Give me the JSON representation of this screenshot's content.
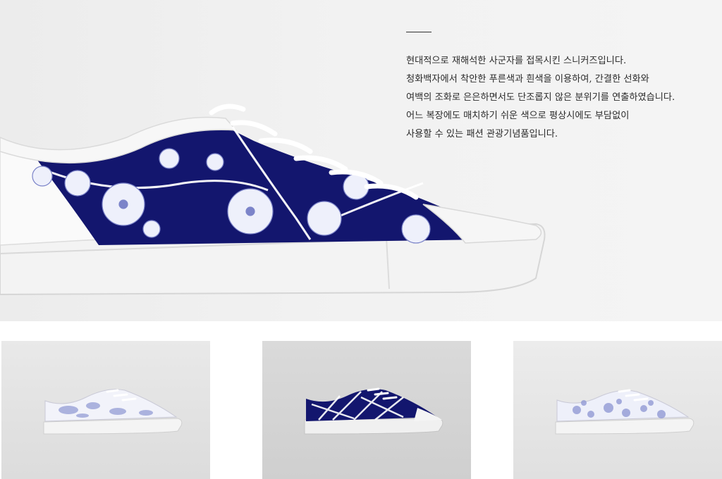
{
  "description": {
    "lines": [
      "현대적으로 재해석한 사군자를 접목시킨 스니커즈입니다.",
      "청화백자에서 착안한 푸른색과 흰색을 이용하여, 간결한 선화와",
      "여백의 조화로 은은하면서도 단조롭지 않은 분위기를 연출하였습니다.",
      "어느 복장에도 매치하기 쉬운 색으로 평상시에도 부담없이",
      "사용할 수 있는 패션 관광기념품입니다."
    ]
  },
  "colors": {
    "cobalt": "#13166e",
    "porcelain_blue": "#6f78c8",
    "white": "#ffffff"
  },
  "thumbnails": [
    {
      "pattern": "light-floral-on-white"
    },
    {
      "pattern": "bamboo-on-cobalt"
    },
    {
      "pattern": "light-floral-on-white"
    }
  ]
}
